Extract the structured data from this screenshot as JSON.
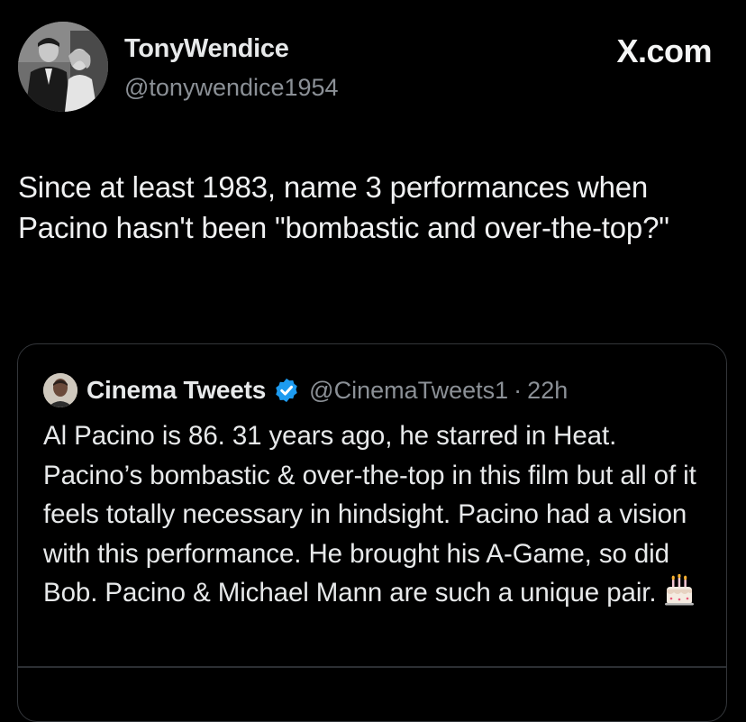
{
  "post": {
    "author_name": "TonyWendice",
    "author_handle": "@tonywendice1954",
    "site_label": "X.com",
    "text": "Since at least 1983, name 3 performances when Pacino hasn't been \"bombastic and over-the-top?\"",
    "avatar_icon": "profile-photo-icon"
  },
  "quote": {
    "author_name": "Cinema Tweets",
    "author_handle": "@CinemaTweets1",
    "separator": "·",
    "time": "22h",
    "text": "Al Pacino is 86. 31 years ago, he starred in Heat. Pacino’s bombastic & over-the-top in this film but all of it feels totally necessary in hindsight. Pacino had a vision with this performance. He brought his A-Game, so did Bob. Pacino & Michael Mann are such a unique pair.",
    "verified_icon": "verified-badge-icon",
    "emoji_icon": "birthday-cake-icon",
    "verified_color": "#1d9bf0"
  }
}
